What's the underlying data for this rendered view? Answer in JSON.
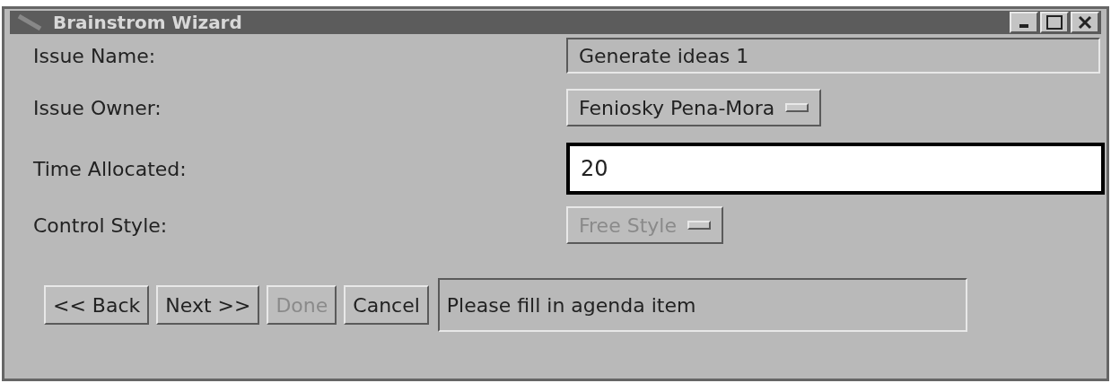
{
  "window": {
    "title": "Brainstrom Wizard"
  },
  "fields": [
    {
      "kind": "readonly",
      "label": "Issue Name:",
      "value": "Generate ideas 1"
    },
    {
      "kind": "menu",
      "label": "Issue Owner:",
      "value": "Feniosky Pena-Mora",
      "disabled": false
    },
    {
      "kind": "input",
      "label": "Time Allocated:",
      "value": "20",
      "focused": true
    },
    {
      "kind": "menu",
      "label": "Control Style:",
      "value": "Free Style",
      "disabled": true
    }
  ],
  "buttons": [
    {
      "label": "<< Back",
      "disabled": false
    },
    {
      "label": "Next >>",
      "disabled": false
    },
    {
      "label": "Done",
      "disabled": true
    },
    {
      "label": "Cancel",
      "disabled": false
    }
  ],
  "status": "Please fill in agenda item"
}
